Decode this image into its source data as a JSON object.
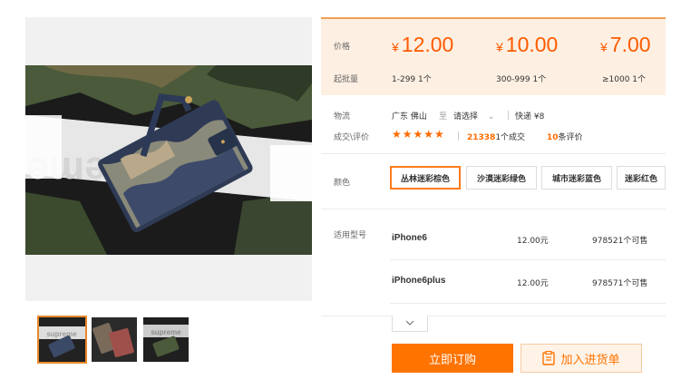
{
  "gallery": {
    "photo_text": "Supreme",
    "thumbnails": [
      {
        "text": "supreme"
      },
      {
        "text": ""
      },
      {
        "text": "supreme"
      }
    ]
  },
  "price": {
    "price_label": "价格",
    "qty_label": "起批量",
    "tiers": [
      {
        "price": "12.00",
        "range": "1-299 1个"
      },
      {
        "price": "10.00",
        "range": "300-999 1个"
      },
      {
        "price": "7.00",
        "range": "≥1000 1个"
      }
    ],
    "currency": "¥"
  },
  "logistics": {
    "label": "物流",
    "from": "广东 佛山",
    "to_word": "至",
    "destination": "请选择",
    "express": "快递 ¥8"
  },
  "sales": {
    "label": "成交\\评价",
    "stars": "★★★★★",
    "deals_count": "21338",
    "deals_suffix": "1个成交",
    "reviews_count": "10",
    "reviews_suffix": "条评价"
  },
  "color": {
    "label": "颜色",
    "options": [
      "丛林迷彩棕色",
      "沙漠迷彩绿色",
      "城市迷彩蓝色",
      "迷彩红色"
    ]
  },
  "models": {
    "label": "适用型号",
    "rows": [
      {
        "name": "iPhone6",
        "price": "12.00元",
        "stock": "978521个可售"
      },
      {
        "name": "iPhone6plus",
        "price": "12.00元",
        "stock": "978571个可售"
      }
    ]
  },
  "actions": {
    "buy": "立即订购",
    "add_to_list": "加入进货单"
  },
  "colors": {
    "accent": "#ff7300",
    "price": "#ff5b00"
  }
}
